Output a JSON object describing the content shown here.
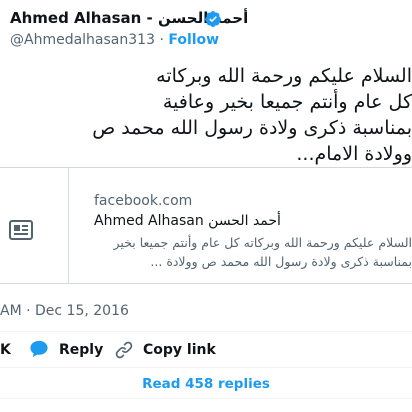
{
  "author": {
    "name": "Ahmed Alhasan - أحمد الحسن",
    "handle": "@Ahmedalhasan313",
    "separator": "·",
    "follow_label": "Follow"
  },
  "tweet": {
    "lines": [
      "السلام عليكم ورحمة الله وبركاته",
      "كل عام وأنتم جميعا بخير وعافية",
      "بمناسبة ذكرى ولادة رسول الله محمد ص",
      "وولادة الامام..."
    ]
  },
  "card": {
    "domain": "facebook.com",
    "title": "Ahmed Alhasan أحمد الحسن",
    "description_lines": [
      "السلام عليكم ورحمة الله وبركاته كل عام وأنتم جميعا بخير",
      "بمناسبة ذكرى ولادة رسول الله محمد ص وولادة ..."
    ]
  },
  "timestamp": "AM · Dec 15, 2016",
  "actions": {
    "like_cut": "K",
    "reply_label": "Reply",
    "copy_label": "Copy link"
  },
  "read_replies": "Read 458 replies",
  "colors": {
    "accent": "#1d9bf0",
    "text": "#0f1419",
    "muted": "#536471",
    "border": "#cfd9de"
  },
  "icons": [
    "verified-badge-icon",
    "newspaper-icon",
    "reply-bubble-icon",
    "link-icon"
  ]
}
